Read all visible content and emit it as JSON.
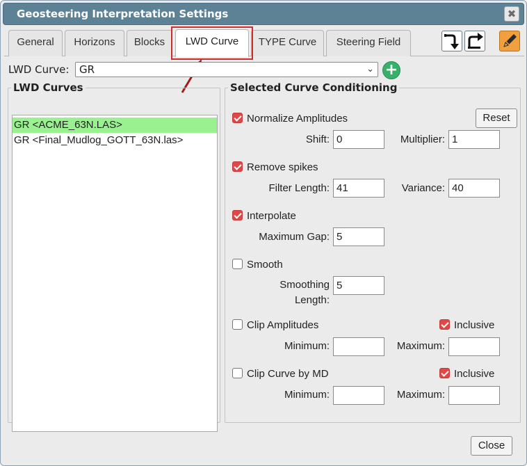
{
  "window": {
    "title": "Geosteering Interpretation Settings",
    "close_glyph": "✖"
  },
  "tabs": [
    "General",
    "Horizons",
    "Blocks",
    "LWD Curve",
    "TYPE Curve",
    "Steering Field"
  ],
  "active_tab": "LWD Curve",
  "lwd_curve": {
    "label": "LWD Curve:",
    "selected": "GR",
    "add_glyph": "+"
  },
  "lwd_curves": {
    "legend": "LWD Curves",
    "items": [
      "GR <ACME_63N.LAS>",
      "GR <Final_Mudlog_GOTT_63N.las>"
    ]
  },
  "conditioning": {
    "legend": "Selected Curve Conditioning",
    "reset_label": "Reset",
    "normalize": {
      "label": "Normalize Amplitudes",
      "checked": true,
      "shift_label": "Shift:",
      "shift_value": "0",
      "multiplier_label": "Multiplier:",
      "multiplier_value": "1"
    },
    "spikes": {
      "label": "Remove spikes",
      "checked": true,
      "filter_label": "Filter Length:",
      "filter_value": "41",
      "variance_label": "Variance:",
      "variance_value": "40"
    },
    "interpolate": {
      "label": "Interpolate",
      "checked": true,
      "gap_label": "Maximum Gap:",
      "gap_value": "5"
    },
    "smooth": {
      "label": "Smooth",
      "checked": false,
      "len_label_1": "Smoothing",
      "len_label_2": "Length:",
      "len_value": "5"
    },
    "clip_amp": {
      "label": "Clip Amplitudes",
      "checked": false,
      "inclusive_label": "Inclusive",
      "inclusive_checked": true,
      "min_label": "Minimum:",
      "min_value": "",
      "max_label": "Maximum:",
      "max_value": ""
    },
    "clip_md": {
      "label": "Clip Curve by MD",
      "checked": false,
      "inclusive_label": "Inclusive",
      "inclusive_checked": true,
      "min_label": "Minimum:",
      "min_value": "",
      "max_label": "Maximum:",
      "max_value": ""
    }
  },
  "close_label": "Close",
  "colors": {
    "titlebar": "#5d8295",
    "selected_row": "#99f28f",
    "checkbox_on": "#e04848",
    "annotation": "#d22b2b",
    "add_button": "#37b06a"
  }
}
